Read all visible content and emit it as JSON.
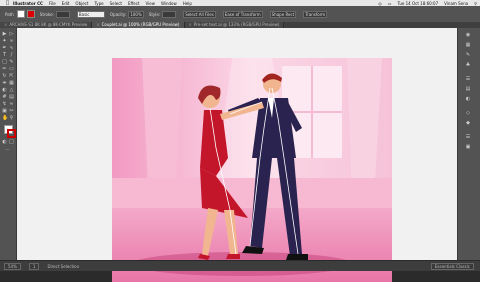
{
  "menubar": {
    "app_name": "Illustrator CC",
    "items": [
      "File",
      "Edit",
      "Object",
      "Type",
      "Select",
      "Effect",
      "View",
      "Window",
      "Help"
    ],
    "clock": "Tue 14 Oct 18:60:07",
    "user": "Vinam Sena"
  },
  "controlbar": {
    "selection_label": "Path",
    "stroke_label": "Stroke:",
    "brush_value": "Basic",
    "opacity_label": "Opacity:",
    "opacity_value": "100%",
    "style_label": "Style:",
    "align_label": "Select All Files",
    "transform_label": "Transform",
    "ease_label": "Ease of Transform",
    "shape_label": "Shape Rect"
  },
  "tabs": [
    {
      "label": "ARCHIVE-S1 8K 8K @ 8K-CMYK Preview",
      "active": false
    },
    {
      "label": "Couplet.ai @ 100% (RGB/GPU Preview)",
      "active": true
    },
    {
      "label": "Pre-set text.ai @ 133% (RGB/GPU Preview)",
      "active": false
    }
  ],
  "workspace": {
    "label": "Essentials Classic"
  },
  "statusbar": {
    "zoom": "54%",
    "artboard": "1",
    "tool": "Direct Selection"
  },
  "colors": {
    "artboard_bg": "#f7c9dc",
    "ui_dark": "#535353",
    "dress_red": "#c4162a",
    "suit_navy": "#2a2350"
  }
}
